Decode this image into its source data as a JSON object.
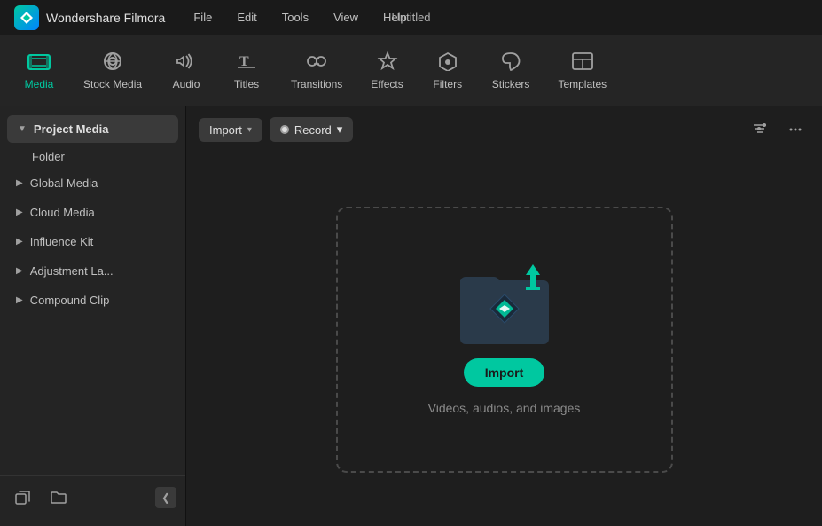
{
  "titlebar": {
    "app_name": "Wondershare Filmora",
    "menu_items": [
      "File",
      "Edit",
      "Tools",
      "View",
      "Help"
    ],
    "document_title": "Untitled"
  },
  "toolbar": {
    "items": [
      {
        "id": "media",
        "label": "Media",
        "icon": "🎞",
        "active": true
      },
      {
        "id": "stock-media",
        "label": "Stock Media",
        "icon": "📷"
      },
      {
        "id": "audio",
        "label": "Audio",
        "icon": "♪"
      },
      {
        "id": "titles",
        "label": "Titles",
        "icon": "T"
      },
      {
        "id": "transitions",
        "label": "Transitions",
        "icon": "↔"
      },
      {
        "id": "effects",
        "label": "Effects",
        "icon": "✦"
      },
      {
        "id": "filters",
        "label": "Filters",
        "icon": "⬡"
      },
      {
        "id": "stickers",
        "label": "Stickers",
        "icon": "❋"
      },
      {
        "id": "templates",
        "label": "Templates",
        "icon": "⊞"
      }
    ]
  },
  "sidebar": {
    "project_media_label": "Project Media",
    "folder_label": "Folder",
    "sections": [
      {
        "id": "global-media",
        "label": "Global Media"
      },
      {
        "id": "cloud-media",
        "label": "Cloud Media"
      },
      {
        "id": "influence-kit",
        "label": "Influence Kit"
      },
      {
        "id": "adjustment-layer",
        "label": "Adjustment La..."
      },
      {
        "id": "compound-clip",
        "label": "Compound Clip"
      }
    ]
  },
  "content": {
    "import_label": "Import",
    "record_label": "Record",
    "import_chevron": "▾",
    "record_chevron": "▾",
    "drop_zone": {
      "import_btn_label": "Import",
      "description": "Videos, audios, and images"
    }
  },
  "icons": {
    "filter_icon": "⊟",
    "more_icon": "•••",
    "new_folder_icon": "⊡",
    "folder_icon": "📁",
    "collapse_icon": "❮"
  }
}
